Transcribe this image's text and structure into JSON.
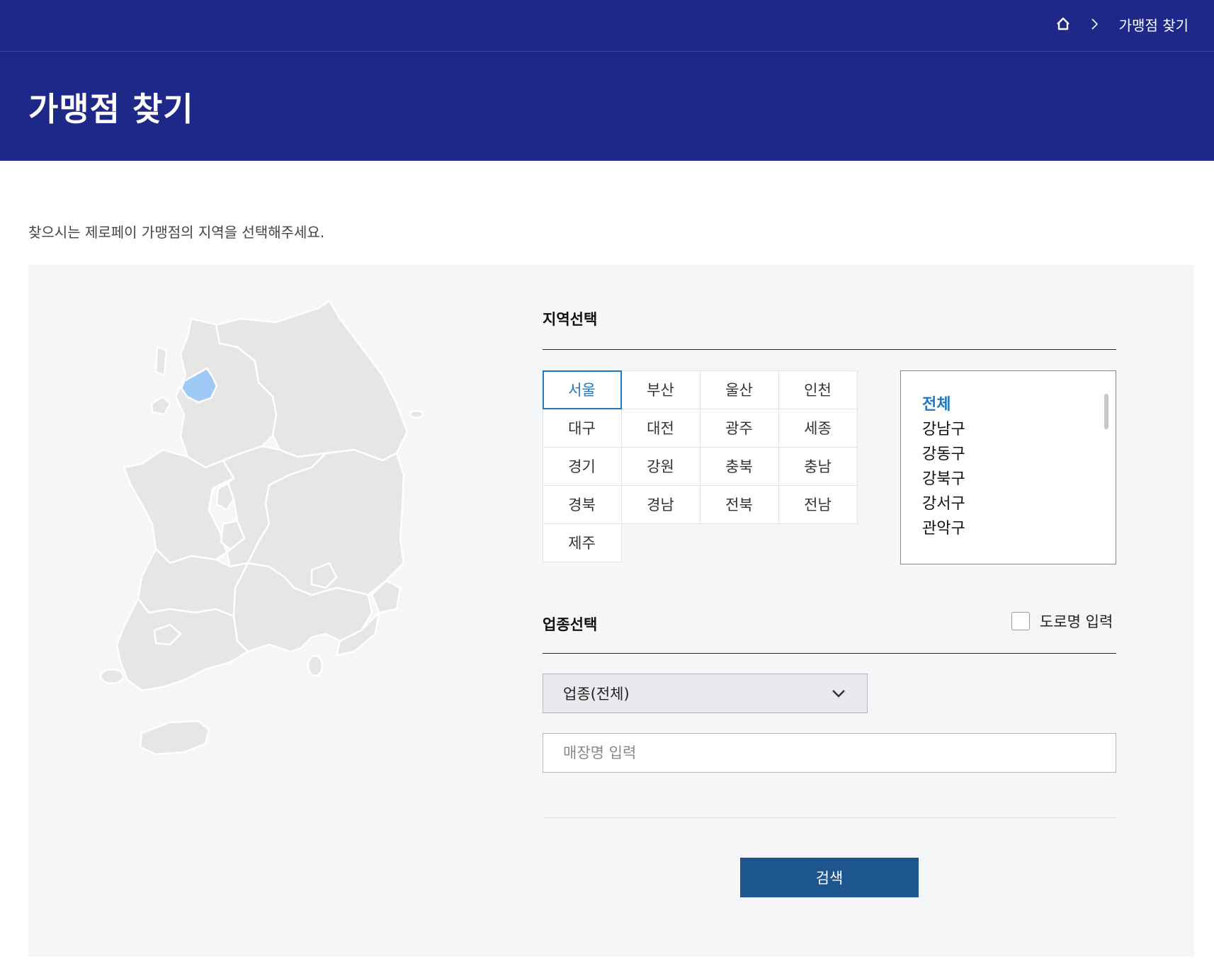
{
  "header": {
    "breadcrumb_current": "가맹점 찾기",
    "title": "가맹점 찾기",
    "home_icon": "home-icon",
    "separator_icon": "chevron-right-icon"
  },
  "intro": "찾으시는 제로페이 가맹점의 지역을 선택해주세요.",
  "region_section": {
    "title": "지역선택",
    "regions": [
      "서울",
      "부산",
      "울산",
      "인천",
      "대구",
      "대전",
      "광주",
      "세종",
      "경기",
      "강원",
      "충북",
      "충남",
      "경북",
      "경남",
      "전북",
      "전남",
      "제주"
    ],
    "selected": "서울"
  },
  "districts": {
    "items": [
      "전체",
      "강남구",
      "강동구",
      "강북구",
      "강서구",
      "관악구"
    ],
    "selected": "전체"
  },
  "business_section": {
    "title": "업종선택",
    "road_name_label": "도로명 입력",
    "category_value": "업종(전체)",
    "store_placeholder": "매장명 입력"
  },
  "search_button": "검색",
  "colors": {
    "header_bg": "#1e2888",
    "accent": "#1e78c8",
    "button": "#1d568e",
    "map_region": "#e6e6e6",
    "map_selected": "#9fcaf6"
  }
}
